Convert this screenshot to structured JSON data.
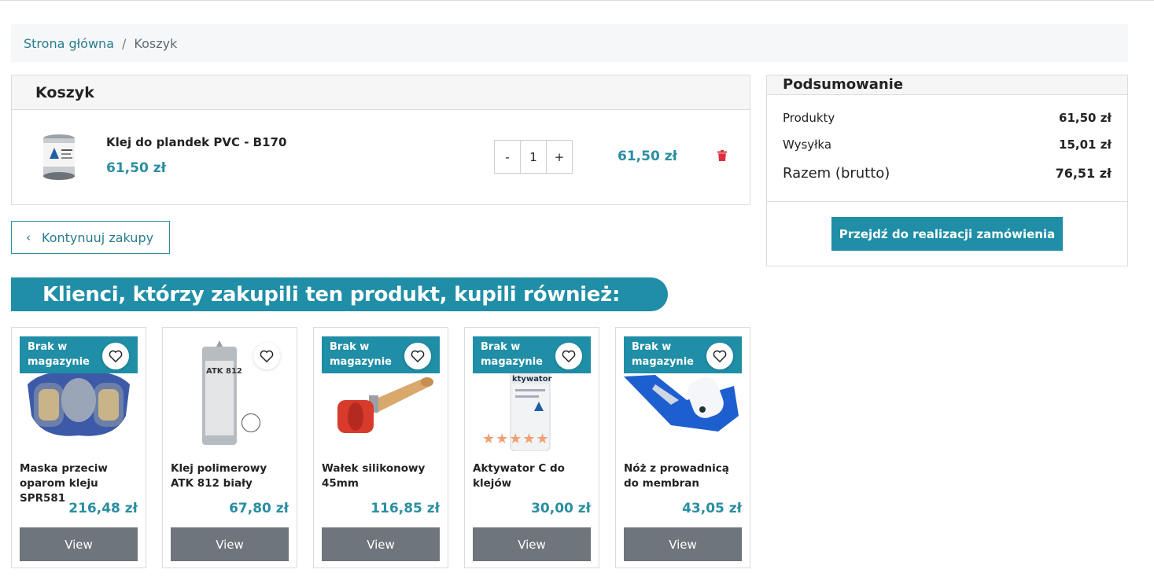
{
  "breadcrumb": {
    "home": "Strona główna",
    "separator": "/",
    "current": "Koszyk"
  },
  "cart": {
    "title": "Koszyk",
    "item": {
      "name": "Klej do plandek PVC - B170",
      "unit_price": "61,50 zł",
      "qty_minus": "-",
      "quantity": "1",
      "qty_plus": "+",
      "line_total": "61,50 zł",
      "image_icon": "glue-can-icon"
    }
  },
  "continue_button": {
    "chevron": "‹",
    "label": "Kontynuuj zakupy"
  },
  "summary": {
    "title": "Podsumowanie",
    "products_label": "Produkty",
    "products_value": "61,50 zł",
    "shipping_label": "Wysyłka",
    "shipping_value": "15,01 zł",
    "total_label": "Razem (brutto)",
    "total_value": "76,51 zł",
    "checkout_label": "Przejdź do realizacji zamówienia"
  },
  "recommendations": {
    "title": "Klienci, którzy zakupili ten produkt, kupili również:",
    "products": [
      {
        "badge": "Brak w magazynie",
        "name": "Maska przeciw oparom kleju SPR581",
        "price": "216,48 zł",
        "view": "View"
      },
      {
        "badge": "",
        "name": "Klej polimerowy ATK 812 biały",
        "price": "67,80 zł",
        "view": "View",
        "label_text": "ATK 812"
      },
      {
        "badge": "Brak w magazynie",
        "name": "Wałek silikonowy 45mm",
        "price": "116,85 zł",
        "view": "View"
      },
      {
        "badge": "Brak w magazynie",
        "name": "Aktywator C do klejów",
        "price": "30,00 zł",
        "view": "View",
        "rating": 5,
        "label_text": "ktywator"
      },
      {
        "badge": "Brak w magazynie",
        "name": "Nóż z prowadnicą do membran",
        "price": "43,05 zł",
        "view": "View"
      }
    ]
  },
  "colors": {
    "accent": "#1f8ea6",
    "price": "#2a8ea0",
    "view_button": "#6e757c",
    "trash": "#d9303f",
    "stars": "#f0a073"
  }
}
